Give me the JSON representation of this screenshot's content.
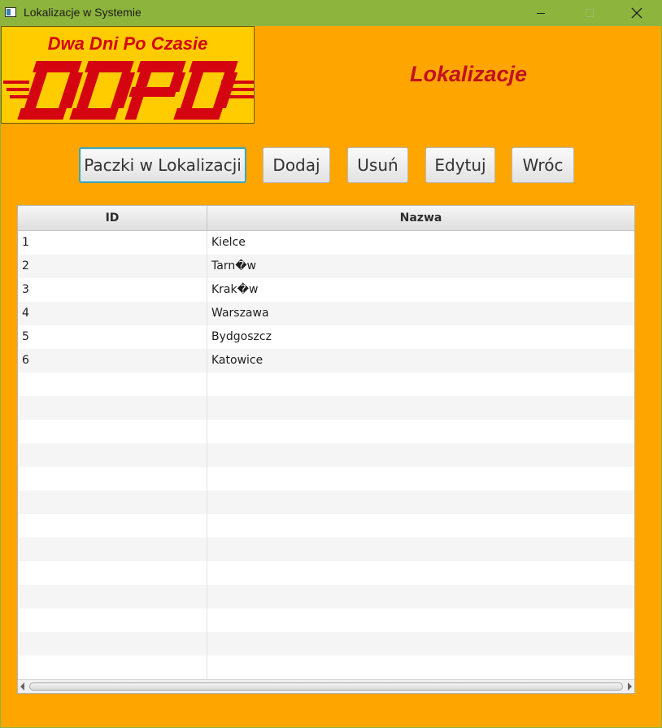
{
  "window": {
    "title": "Lokalizacje w Systemie"
  },
  "logo": {
    "slogan": "Dwa Dni Po Czasie",
    "brand": "DDPD",
    "colors": {
      "background": "#ffcc00",
      "mark": "#d40511"
    }
  },
  "header": {
    "title": "Lokalizacje"
  },
  "toolbar": {
    "packages_label": "Paczki w Lokalizacji",
    "add_label": "Dodaj",
    "delete_label": "Usuń",
    "edit_label": "Edytuj",
    "back_label": "Wróc"
  },
  "table": {
    "columns": [
      "ID",
      "Nazwa"
    ],
    "rows": [
      {
        "id": "1",
        "name": "Kielce"
      },
      {
        "id": "2",
        "name": "Tarn�w"
      },
      {
        "id": "3",
        "name": "Krak�w"
      },
      {
        "id": "4",
        "name": "Warszawa"
      },
      {
        "id": "5",
        "name": "Bydgoszcz"
      },
      {
        "id": "6",
        "name": "Katowice"
      }
    ],
    "empty_rows_shown": 13
  },
  "colors": {
    "background": "#ffa500",
    "titlebar": "#8db43d",
    "title_text": "#c1121f",
    "focus": "#40a4b6"
  }
}
